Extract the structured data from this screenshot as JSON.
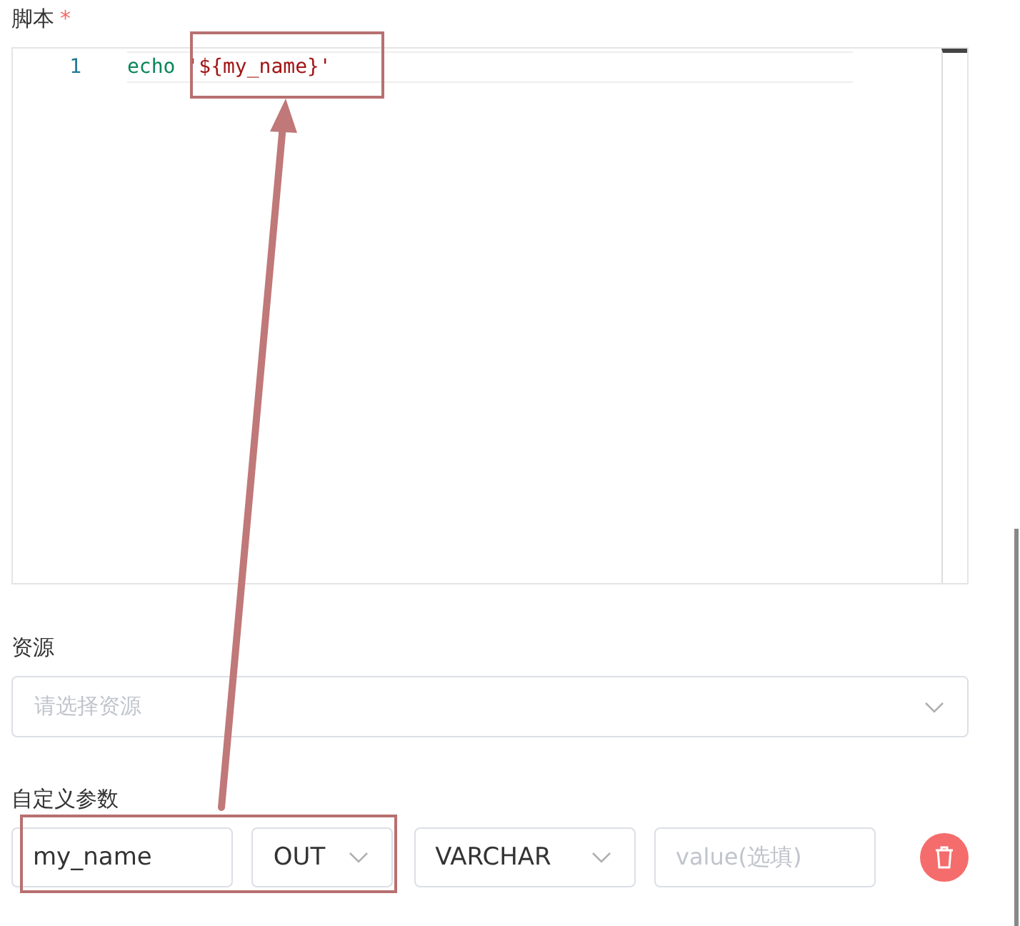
{
  "script": {
    "label": "脚本",
    "required_mark": "*",
    "lines": [
      {
        "number": "1",
        "keyword": "echo",
        "string": "'${my_name}'"
      }
    ]
  },
  "resource": {
    "label": "资源",
    "placeholder": "请选择资源"
  },
  "custom_params": {
    "label": "自定义参数",
    "rows": [
      {
        "name": "my_name",
        "direction": "OUT",
        "type": "VARCHAR",
        "value_placeholder": "value(选填)"
      }
    ]
  }
}
